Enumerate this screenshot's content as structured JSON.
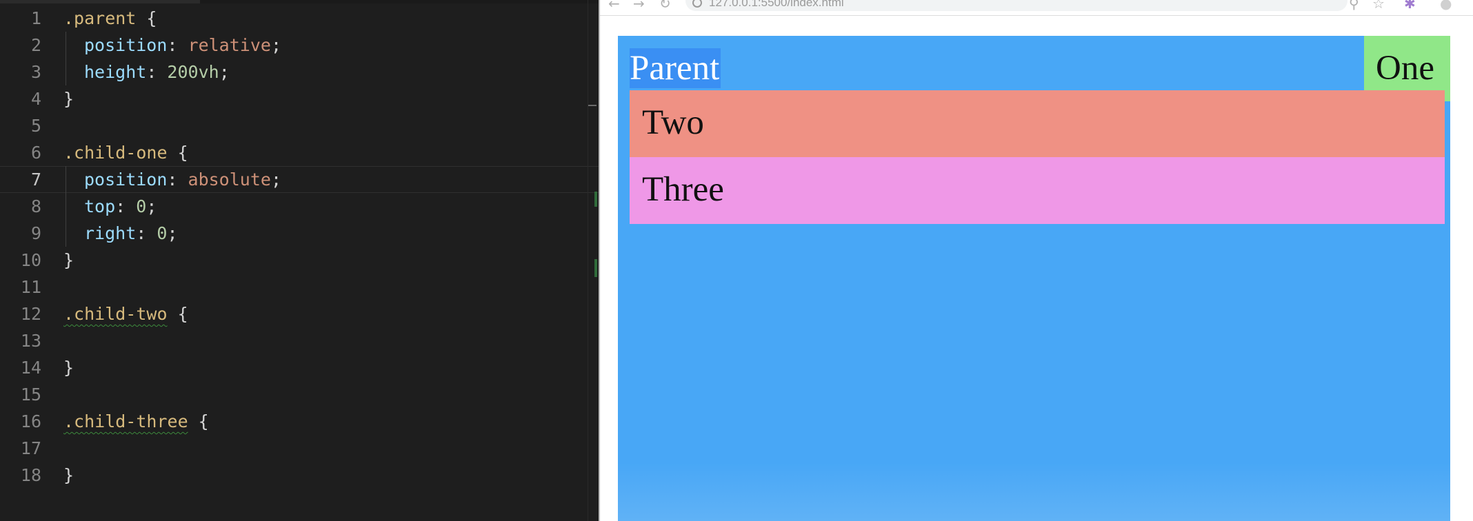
{
  "editor": {
    "lines": [
      {
        "n": "1",
        "parts": [
          {
            "t": ".parent",
            "c": "sel"
          },
          {
            "t": " {",
            "c": "punc"
          }
        ]
      },
      {
        "n": "2",
        "indent": true,
        "parts": [
          {
            "t": "position",
            "c": "prop"
          },
          {
            "t": ": ",
            "c": "punc"
          },
          {
            "t": "relative",
            "c": "val"
          },
          {
            "t": ";",
            "c": "punc"
          }
        ]
      },
      {
        "n": "3",
        "indent": true,
        "parts": [
          {
            "t": "height",
            "c": "prop"
          },
          {
            "t": ": ",
            "c": "punc"
          },
          {
            "t": "200vh",
            "c": "num"
          },
          {
            "t": ";",
            "c": "punc"
          }
        ]
      },
      {
        "n": "4",
        "parts": [
          {
            "t": "}",
            "c": "punc"
          }
        ]
      },
      {
        "n": "5",
        "parts": []
      },
      {
        "n": "6",
        "parts": [
          {
            "t": ".child-one",
            "c": "sel"
          },
          {
            "t": " {",
            "c": "punc"
          }
        ]
      },
      {
        "n": "7",
        "indent": true,
        "current": true,
        "parts": [
          {
            "t": "position",
            "c": "prop"
          },
          {
            "t": ": ",
            "c": "punc"
          },
          {
            "t": "absolute",
            "c": "val"
          },
          {
            "t": ";",
            "c": "punc"
          }
        ]
      },
      {
        "n": "8",
        "indent": true,
        "parts": [
          {
            "t": "top",
            "c": "prop"
          },
          {
            "t": ": ",
            "c": "punc"
          },
          {
            "t": "0",
            "c": "num"
          },
          {
            "t": ";",
            "c": "punc"
          }
        ]
      },
      {
        "n": "9",
        "indent": true,
        "parts": [
          {
            "t": "right",
            "c": "prop"
          },
          {
            "t": ": ",
            "c": "punc"
          },
          {
            "t": "0",
            "c": "num"
          },
          {
            "t": ";",
            "c": "punc"
          }
        ]
      },
      {
        "n": "10",
        "parts": [
          {
            "t": "}",
            "c": "punc"
          }
        ]
      },
      {
        "n": "11",
        "parts": []
      },
      {
        "n": "12",
        "parts": [
          {
            "t": ".child-two",
            "c": "sel squiggle"
          },
          {
            "t": " {",
            "c": "punc"
          }
        ]
      },
      {
        "n": "13",
        "parts": []
      },
      {
        "n": "14",
        "parts": [
          {
            "t": "}",
            "c": "punc"
          }
        ]
      },
      {
        "n": "15",
        "parts": []
      },
      {
        "n": "16",
        "parts": [
          {
            "t": ".child-three",
            "c": "sel squiggle"
          },
          {
            "t": " {",
            "c": "punc"
          }
        ]
      },
      {
        "n": "17",
        "parts": []
      },
      {
        "n": "18",
        "parts": [
          {
            "t": "}",
            "c": "punc"
          }
        ]
      }
    ]
  },
  "browser": {
    "url": "127.0.0.1:5500/index.html",
    "icons": {
      "back": "back-arrow-icon",
      "forward": "forward-arrow-icon",
      "reload": "reload-icon",
      "info": "info-icon",
      "zoom": "zoom-icon",
      "star": "star-icon"
    },
    "page": {
      "parent_label": "Parent",
      "child_one_label": "One",
      "child_two_label": "Two",
      "child_three_label": "Three"
    },
    "colors": {
      "parent": "#48a7f6",
      "parent_text_highlight": "#3a8ff3",
      "child_one": "#90e788",
      "child_two": "#ef9184",
      "child_three": "#ef98e7"
    }
  }
}
